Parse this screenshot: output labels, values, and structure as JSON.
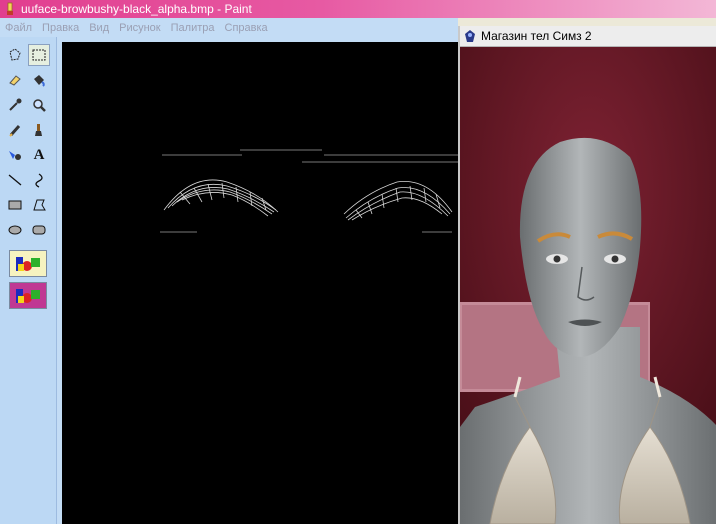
{
  "window": {
    "title": "uuface-browbushy-black_alpha.bmp - Paint",
    "app_icon": "paint-icon"
  },
  "menu": {
    "items": [
      "Файл",
      "Правка",
      "Вид",
      "Рисунок",
      "Палитра",
      "Справка"
    ]
  },
  "toolbox": {
    "tools": [
      {
        "name": "free-select-icon"
      },
      {
        "name": "rect-select-icon",
        "selected": true
      },
      {
        "name": "eraser-icon"
      },
      {
        "name": "fill-bucket-icon"
      },
      {
        "name": "color-picker-icon"
      },
      {
        "name": "magnifier-icon"
      },
      {
        "name": "pencil-icon"
      },
      {
        "name": "brush-icon"
      },
      {
        "name": "airbrush-icon"
      },
      {
        "name": "text-tool-icon",
        "glyph": "A"
      },
      {
        "name": "line-tool-icon"
      },
      {
        "name": "curve-tool-icon"
      },
      {
        "name": "rectangle-tool-icon"
      },
      {
        "name": "polygon-tool-icon"
      },
      {
        "name": "ellipse-tool-icon"
      },
      {
        "name": "rounded-rect-tool-icon"
      }
    ],
    "option_icons": [
      "transparent-option-icon",
      "opaque-option-icon"
    ]
  },
  "secondary_window": {
    "title": "Магазин тел Симз 2",
    "icon": "sims-icon"
  },
  "colors": {
    "title_pink": "#e13e8f",
    "menu_blue": "#c3dcf5",
    "canvas": "#000000",
    "sims_background": "#6b1a26"
  }
}
